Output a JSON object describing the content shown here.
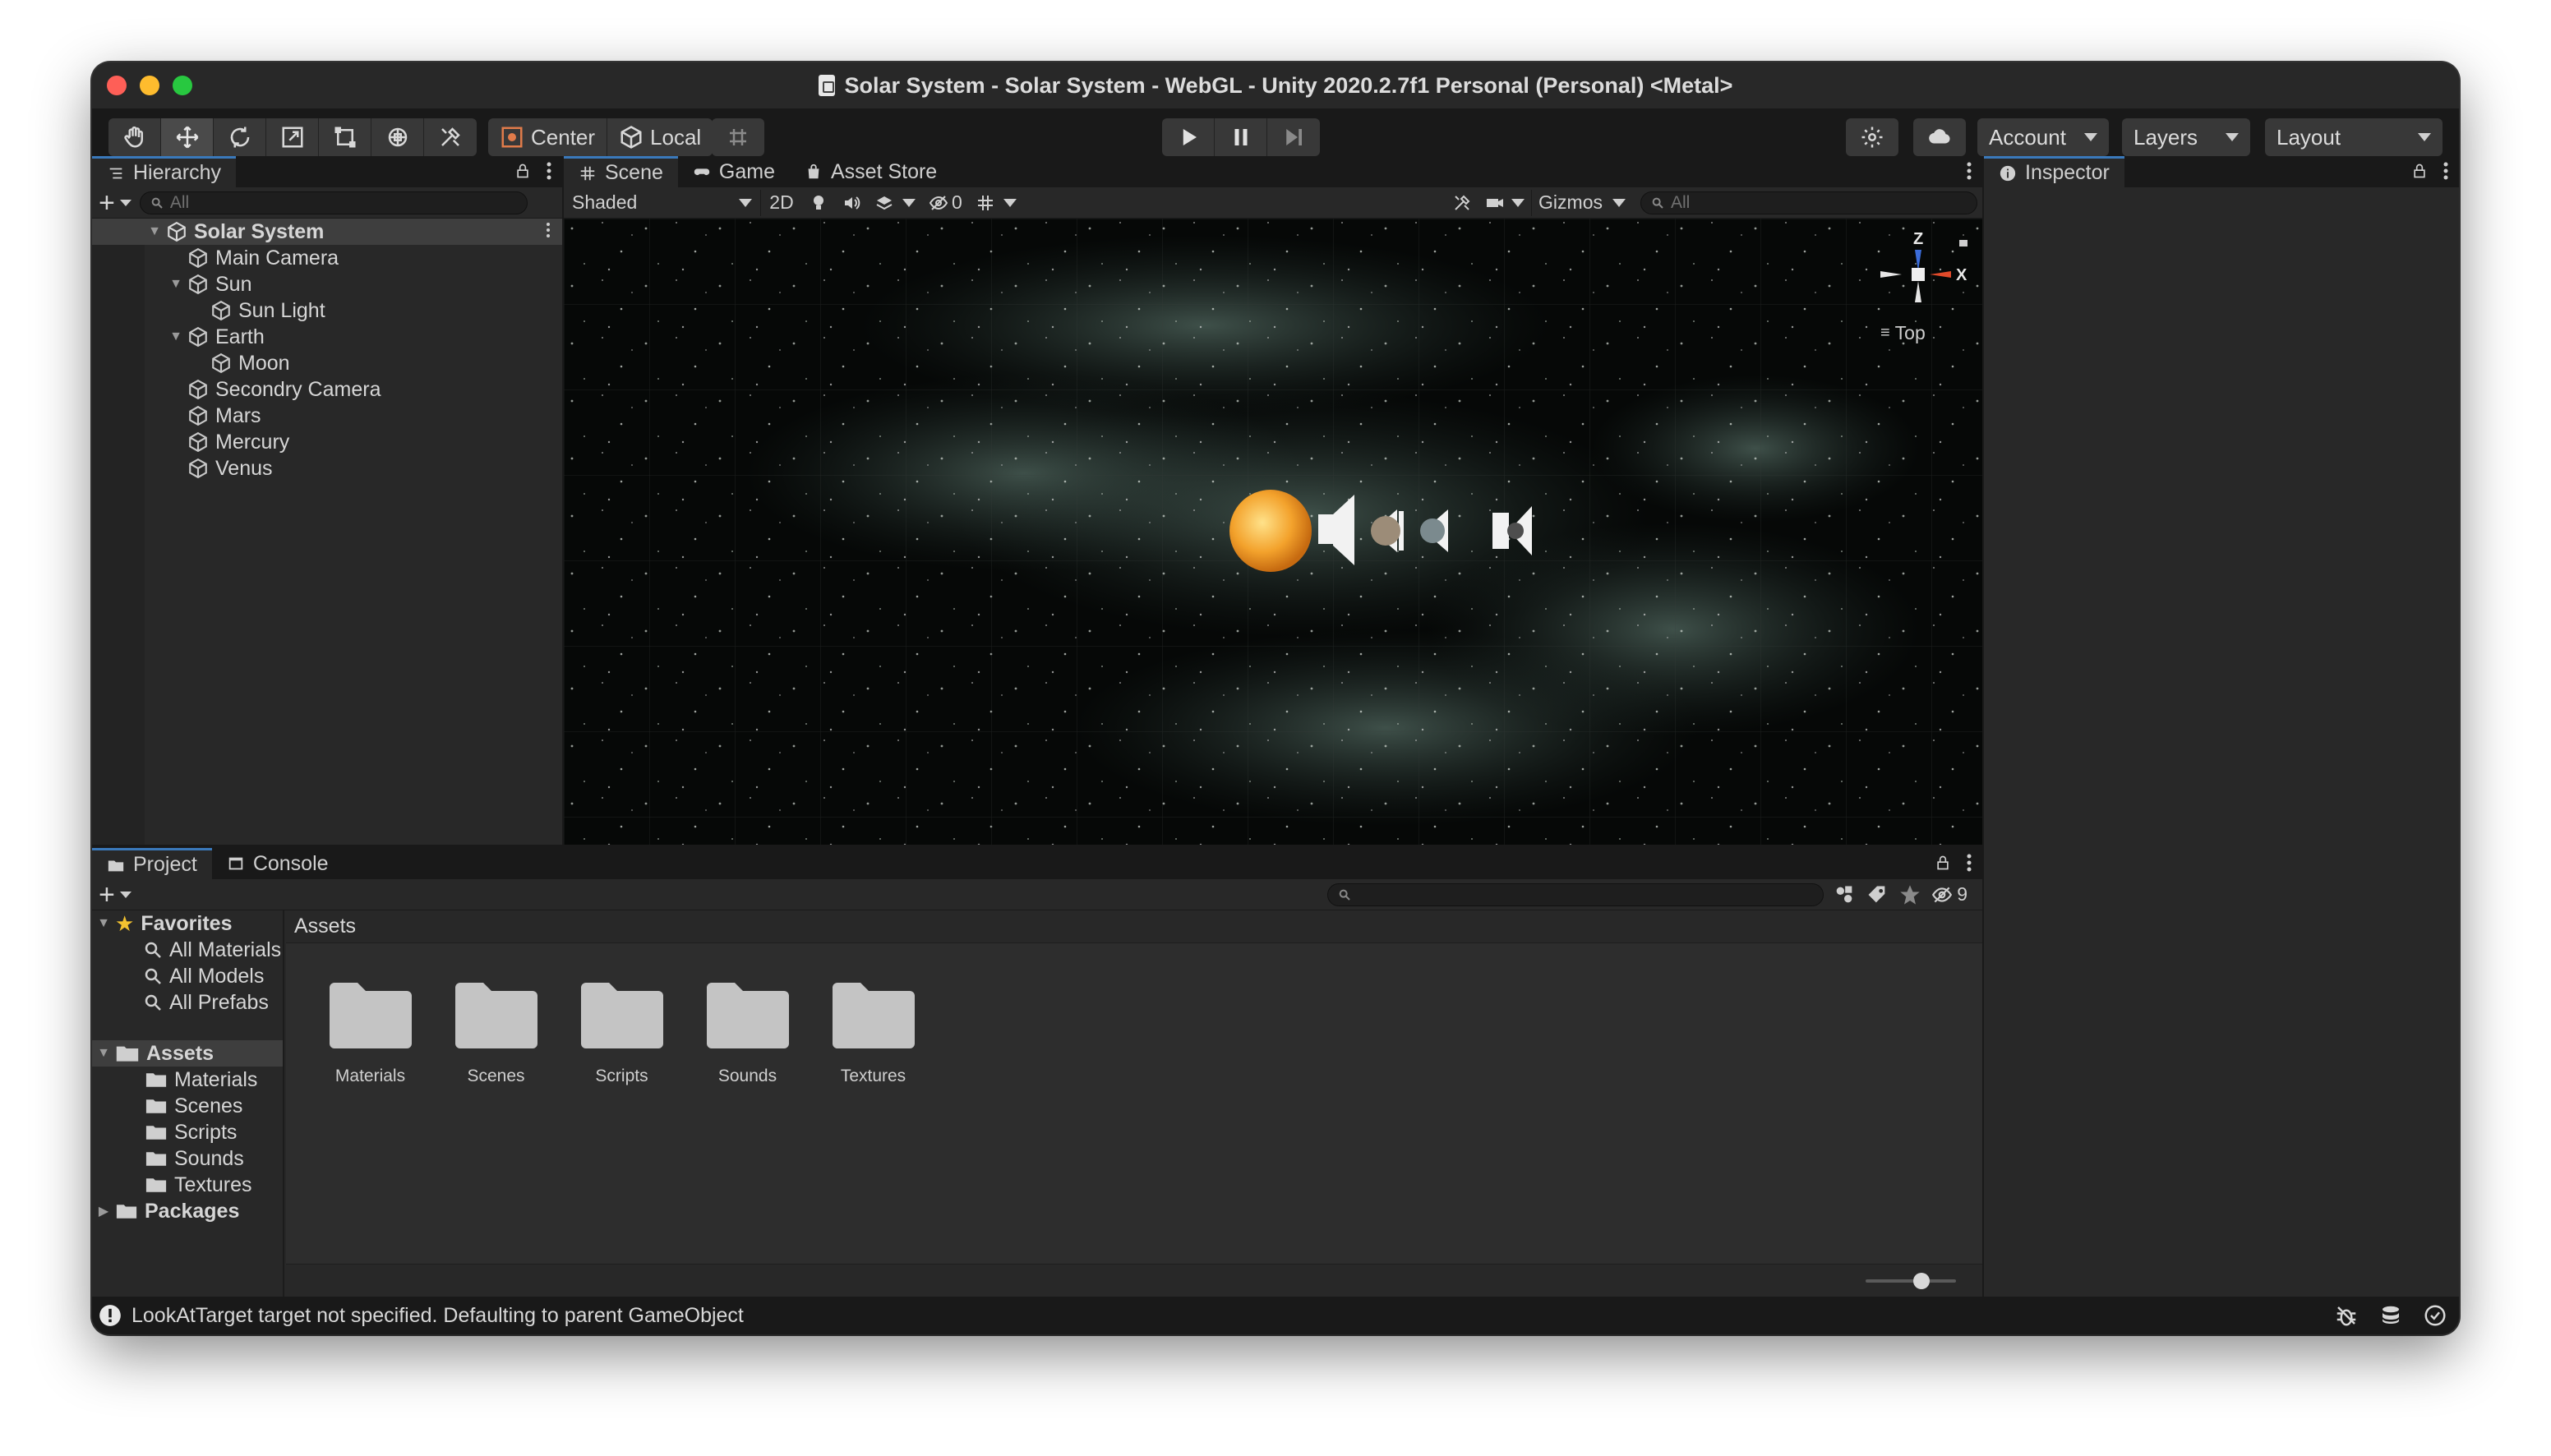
{
  "window": {
    "title": "Solar System - Solar System - WebGL - Unity 2020.2.7f1 Personal (Personal) <Metal>",
    "traffic_lights": {
      "close": "#fe5f57",
      "minimize": "#febc2e",
      "maximize": "#28c840"
    }
  },
  "toolbar": {
    "tools": [
      "hand-tool",
      "move-tool",
      "rotate-tool",
      "scale-tool",
      "rect-tool",
      "transform-tool",
      "custom-tool"
    ],
    "pivot_label": "Center",
    "space_label": "Local",
    "account_label": "Account",
    "layers_label": "Layers",
    "layout_label": "Layout"
  },
  "hierarchy": {
    "tab_label": "Hierarchy",
    "search_placeholder": "All",
    "items": [
      {
        "label": "Solar System",
        "depth": 0,
        "expanded": true,
        "scene": true
      },
      {
        "label": "Main Camera",
        "depth": 1
      },
      {
        "label": "Sun",
        "depth": 1,
        "expanded": true
      },
      {
        "label": "Sun Light",
        "depth": 2
      },
      {
        "label": "Earth",
        "depth": 1,
        "expanded": true
      },
      {
        "label": "Moon",
        "depth": 2
      },
      {
        "label": "Secondry Camera",
        "depth": 1
      },
      {
        "label": "Mars",
        "depth": 1
      },
      {
        "label": "Mercury",
        "depth": 1
      },
      {
        "label": "Venus",
        "depth": 1
      }
    ]
  },
  "scene": {
    "tabs": [
      "Scene",
      "Game",
      "Asset Store"
    ],
    "shading_mode": "Shaded",
    "mode_2d": "2D",
    "hidden_count": "0",
    "gizmos_label": "Gizmos",
    "search_placeholder": "All",
    "orientation_label": "Top",
    "axis_labels": {
      "z": "Z",
      "x": "X"
    }
  },
  "inspector": {
    "tab_label": "Inspector"
  },
  "project": {
    "tabs": [
      "Project",
      "Console"
    ],
    "hidden_count": "9",
    "breadcrumb": "Assets",
    "favorites_label": "Favorites",
    "favorites": [
      "All Materials",
      "All Models",
      "All Prefabs"
    ],
    "assets_label": "Assets",
    "asset_folders": [
      "Materials",
      "Scenes",
      "Scripts",
      "Sounds",
      "Textures"
    ],
    "packages_label": "Packages",
    "grid_folders": [
      "Materials",
      "Scenes",
      "Scripts",
      "Sounds",
      "Textures"
    ]
  },
  "status": {
    "message": "LookAtTarget target not specified. Defaulting to parent GameObject"
  }
}
